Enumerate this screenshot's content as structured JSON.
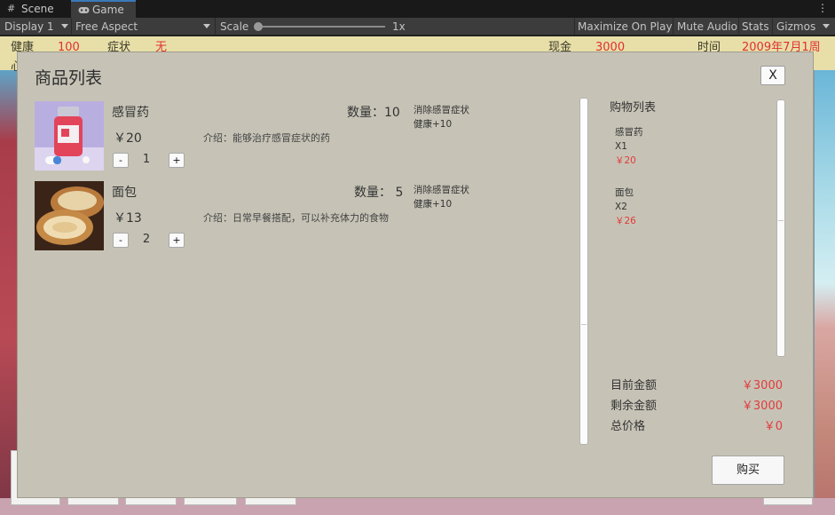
{
  "editor": {
    "tabs": [
      {
        "label": "Scene",
        "icon": "grid-icon"
      },
      {
        "label": "Game",
        "icon": "gamepad-icon"
      }
    ],
    "toolbar": {
      "display": "Display 1",
      "aspect": "Free Aspect",
      "scale_label": "Scale",
      "scale_value": "1x",
      "maximize": "Maximize On Play",
      "mute": "Mute Audio",
      "stats": "Stats",
      "gizmos": "Gizmos"
    }
  },
  "hud": {
    "health_label": "健康",
    "health_value": "100",
    "symptom_label": "症状",
    "symptom_value": "无",
    "cash_label": "现金",
    "cash_value": "3000",
    "time_label": "时间",
    "time_value": "2009年7月1周",
    "partial_label": "心"
  },
  "shop": {
    "title": "商品列表",
    "close": "X",
    "items": [
      {
        "name": "感冒药",
        "price": "￥20",
        "description": "介绍：能够治疗感冒症状的药",
        "stock": "数量：10",
        "effect1": "消除感冒症状",
        "effect2": "健康+10",
        "minus": "-",
        "count": "1",
        "plus": "+"
      },
      {
        "name": "面包",
        "price": "￥13",
        "description": "介绍：日常早餐搭配，可以补充体力的食物",
        "stock": "数量：  5",
        "effect1": "消除感冒症状",
        "effect2": "健康+10",
        "minus": "-",
        "count": "2",
        "plus": "+"
      }
    ],
    "cart": {
      "title": "购物列表",
      "items": [
        {
          "name": "感冒药",
          "qty": "X1",
          "price": "￥20"
        },
        {
          "name": "面包",
          "qty": "X2",
          "price": "￥26"
        }
      ]
    },
    "summary": {
      "current_label": "目前金额",
      "current_value": "￥3000",
      "remaining_label": "剩余金额",
      "remaining_value": "￥3000",
      "total_label": "总价格",
      "total_value": "￥0"
    },
    "buy": "购买"
  },
  "colors": {
    "accent_red": "#e33a3a",
    "panel": "#c6c3b6"
  }
}
